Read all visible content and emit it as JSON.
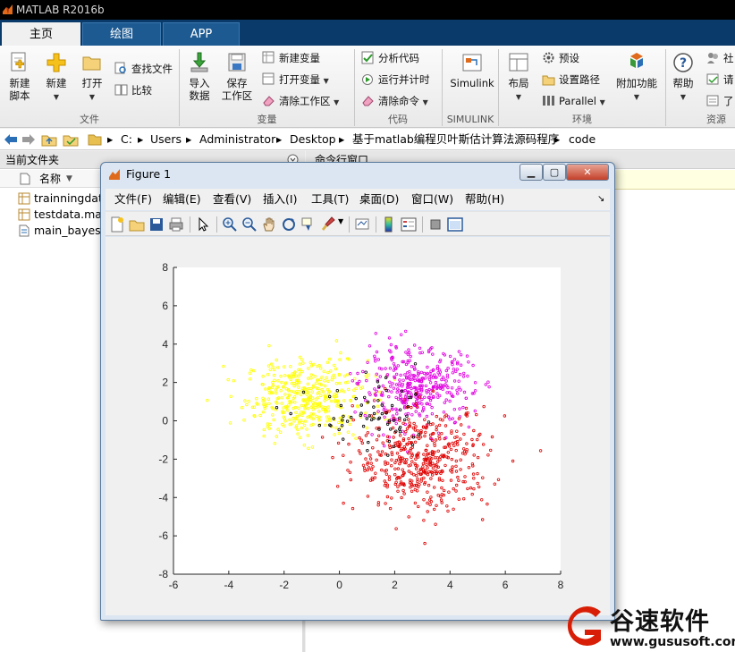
{
  "app": {
    "title": "MATLAB R2016b"
  },
  "tabs": [
    {
      "label": "主页",
      "active": true
    },
    {
      "label": "绘图",
      "active": false
    },
    {
      "label": "APP",
      "active": false
    }
  ],
  "ribbon": {
    "file": {
      "new_script_l1": "新建",
      "new_script_l2": "脚本",
      "new": "新建",
      "open": "打开",
      "find_files": "查找文件",
      "compare": "比较",
      "group": "文件"
    },
    "variable": {
      "import_l1": "导入",
      "import_l2": "数据",
      "save_l1": "保存",
      "save_l2": "工作区",
      "new_var": "新建变量",
      "open_var": "打开变量",
      "clear_ws": "清除工作区",
      "group": "变量"
    },
    "code": {
      "analyze": "分析代码",
      "run_time": "运行并计时",
      "clear_cmd": "清除命令",
      "group": "代码"
    },
    "simulink": {
      "label": "Simulink",
      "group": "SIMULINK"
    },
    "environment": {
      "layout": "布局",
      "prefs": "预设",
      "set_path": "设置路径",
      "parallel": "Parallel",
      "addons": "附加功能",
      "group": "环境"
    },
    "resources": {
      "help": "帮助",
      "community": "社",
      "request": "请",
      "learn": "了",
      "group": "资源"
    }
  },
  "address": {
    "crumbs": [
      "C:",
      "Users",
      "Administrator",
      "Desktop",
      "基于matlab编程贝叶斯估计算法源码程序",
      "code"
    ]
  },
  "current_folder": {
    "title": "当前文件夹",
    "column_name": "名称",
    "files": [
      "trainningdat",
      "testdata.mat",
      "main_bayes."
    ]
  },
  "command_window": {
    "title": "命令行窗口"
  },
  "figure": {
    "title": "Figure 1",
    "menu": [
      "文件(F)",
      "编辑(E)",
      "查看(V)",
      "插入(I)",
      "工具(T)",
      "桌面(D)",
      "窗口(W)",
      "帮助(H)"
    ]
  },
  "chart_data": {
    "type": "scatter",
    "title": "",
    "xlabel": "",
    "ylabel": "",
    "xlim": [
      -6,
      8
    ],
    "ylim": [
      -8,
      8
    ],
    "xticks": [
      -6,
      -4,
      -2,
      0,
      2,
      4,
      6,
      8
    ],
    "yticks": [
      -8,
      -6,
      -4,
      -2,
      0,
      2,
      4,
      6,
      8
    ],
    "grid": false,
    "series": [
      {
        "color": "#ffff00",
        "marker": "o",
        "center": [
          -1.2,
          1.2
        ],
        "spread": [
          1.1,
          1.0
        ],
        "count": 420
      },
      {
        "color": "#e000e0",
        "marker": "o",
        "center": [
          2.8,
          1.7
        ],
        "spread": [
          1.0,
          1.0
        ],
        "count": 380
      },
      {
        "color": "#e00000",
        "marker": "o",
        "center": [
          3.0,
          -2.0
        ],
        "spread": [
          1.2,
          1.3
        ],
        "count": 460
      },
      {
        "color": "#000000",
        "marker": "o",
        "center": [
          1.3,
          0.0
        ],
        "spread": [
          1.2,
          0.9
        ],
        "count": 70
      }
    ]
  },
  "watermark": {
    "brand": "谷速软件",
    "url": "www.gususoft.com"
  }
}
